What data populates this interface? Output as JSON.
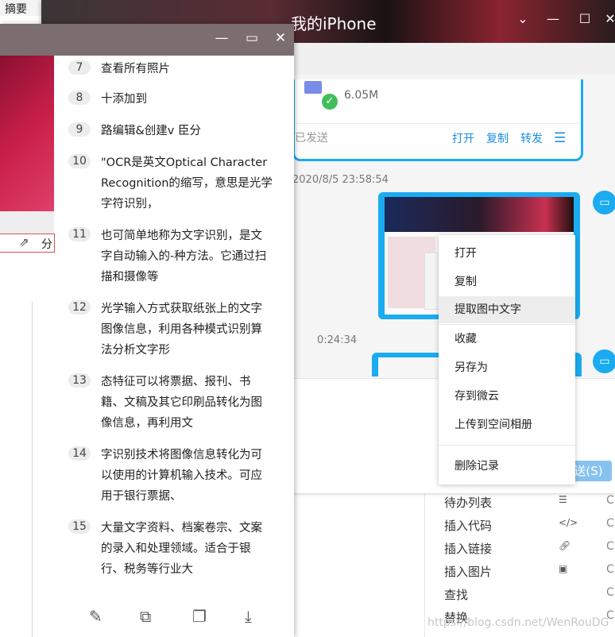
{
  "top_menu": {
    "label": "摘要"
  },
  "chat": {
    "title": "我的iPhone",
    "file_size": "6.05M",
    "sent_status": "已发送",
    "actions": [
      "打开",
      "复制",
      "转发"
    ],
    "time1": "2020/8/5 23:58:54",
    "time2": "0:24:34",
    "send_label": "发送(S)"
  },
  "context_menu": {
    "items": [
      "打开",
      "复制",
      "提取图中文字",
      "收藏",
      "另存为",
      "存到微云",
      "上传到空间相册",
      "删除记录"
    ]
  },
  "right_menu": {
    "items": [
      "待办列表",
      "插入代码",
      "插入链接",
      "插入图片",
      "查找",
      "替换"
    ],
    "icons": [
      "todo-list-icon",
      "code-icon",
      "link-icon",
      "image-icon"
    ],
    "shortcut_prefix": "C"
  },
  "ocr_window": {
    "share_label": "分",
    "lines": [
      {
        "num": "7",
        "text": "查看所有照片"
      },
      {
        "num": "8",
        "text": "十添加到"
      },
      {
        "num": "9",
        "text": "路编辑&创建v 臣分"
      },
      {
        "num": "10",
        "text": "\"OCR是英文Optical Character Recognition的缩写，意思是光学字符识别，"
      },
      {
        "num": "11",
        "text": "也可简单地称为文字识别，是文字自动输入的-种方法。它通过扫描和摄像等"
      },
      {
        "num": "12",
        "text": "光学输入方式获取纸张上的文字图像信息，利用各种模式识别算法分析文字形"
      },
      {
        "num": "13",
        "text": "态特征可以将票据、报刊、书籍、文稿及其它印刷品转化为图像信息，再利用文"
      },
      {
        "num": "14",
        "text": "字识别技术将图像信息转化为可以使用的计算机输入技术。可应用于银行票据、"
      },
      {
        "num": "15",
        "text": "大量文字资料、档案卷宗、文案的录入和处理领域。适合于银行、税务等行业大"
      }
    ],
    "bottom_icons": [
      "edit-icon",
      "translate-icon",
      "copy-icon",
      "download-icon"
    ]
  },
  "watermark": "https://blog.csdn.net/WenRouDG"
}
